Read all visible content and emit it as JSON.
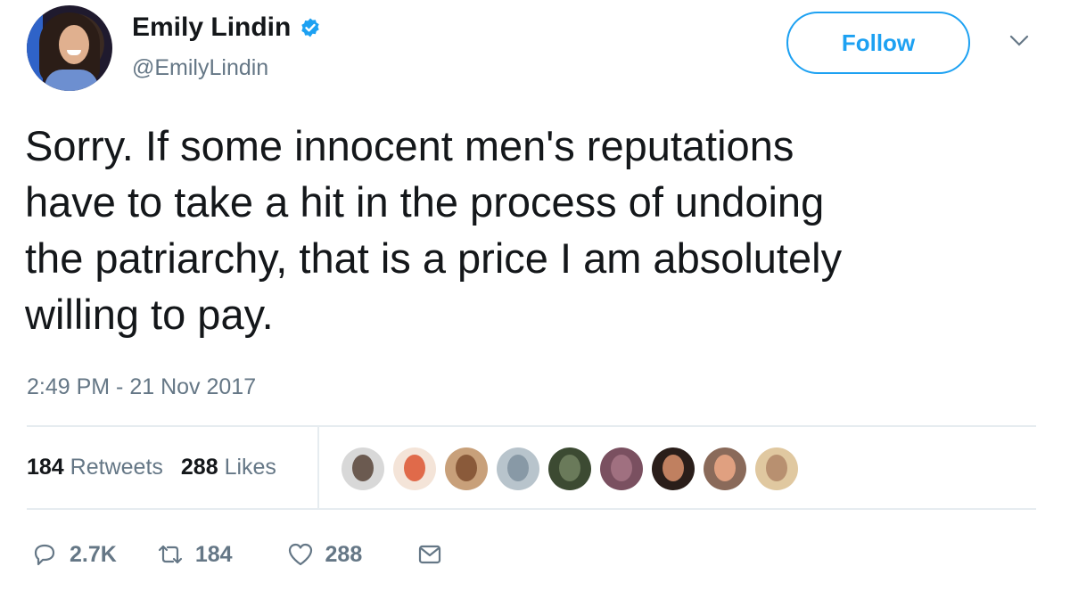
{
  "user": {
    "name": "Emily Lindin",
    "handle": "@EmilyLindin",
    "verified_color": "#1da1f2"
  },
  "follow_label": "Follow",
  "tweet": {
    "lines": [
      "Sorry. If some innocent men's reputations",
      "have to take a hit in the process of undoing",
      "the patriarchy, that is a price I am absolutely",
      "willing to pay."
    ],
    "timestamp": "2:49 PM - 21 Nov 2017"
  },
  "stats": {
    "retweets_count": "184",
    "retweets_label": "Retweets",
    "likes_count": "288",
    "likes_label": "Likes"
  },
  "actions": {
    "reply_count": "2.7K",
    "retweet_count": "184",
    "like_count": "288"
  },
  "likers": [
    {
      "bg": "#d8d8d8",
      "face": "#6b5a50"
    },
    {
      "bg": "#f4e4d8",
      "face": "#e06a4a"
    },
    {
      "bg": "#c8a07a",
      "face": "#8a5a3a"
    },
    {
      "bg": "#b8c4cc",
      "face": "#8899a6"
    },
    {
      "bg": "#3c4a32",
      "face": "#6a7a5a"
    },
    {
      "bg": "#7a5060",
      "face": "#a07080"
    },
    {
      "bg": "#2a1e1a",
      "face": "#c08060"
    },
    {
      "bg": "#8a6a5a",
      "face": "#e0a080"
    },
    {
      "bg": "#e0c8a0",
      "face": "#b89070"
    }
  ],
  "colors": {
    "accent": "#1da1f2",
    "muted": "#657786",
    "text": "#14171a"
  }
}
